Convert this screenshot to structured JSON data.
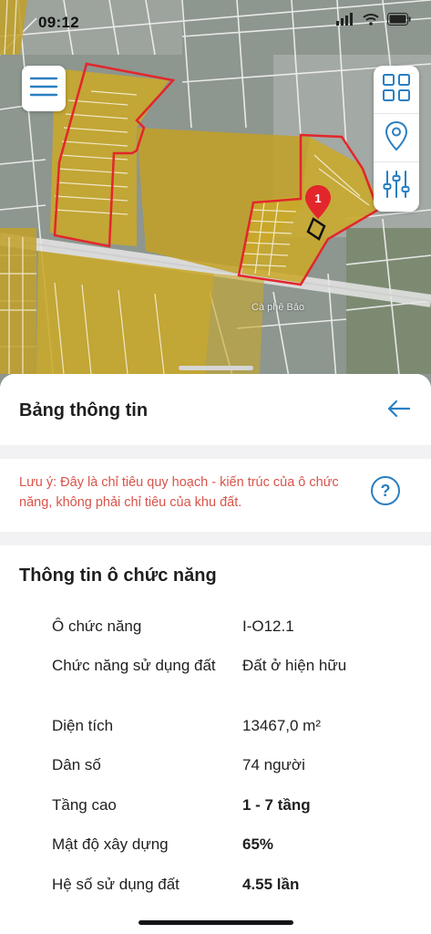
{
  "status_bar": {
    "time": "09:12"
  },
  "map": {
    "place_label": "Cà phê Bảo",
    "marker_number": "1",
    "colors": {
      "zone_fill": "#c9a92a",
      "boundary": "#e3262b",
      "road": "#f5f5f5"
    }
  },
  "controls": {
    "menu_icon": "hamburger-icon",
    "layers_icon": "grid-icon",
    "location_icon": "location-pin-icon",
    "filter_icon": "sliders-icon"
  },
  "sheet": {
    "title": "Bảng thông tin",
    "back_icon": "arrow-left-icon",
    "notice": "Lưu ý: Đây là chỉ tiêu quy hoạch - kiến trúc của ô chức năng, không phải chỉ tiêu của khu đất.",
    "help_label": "?",
    "section_title": "Thông tin ô chức năng",
    "rows": [
      {
        "label": "Ô chức năng",
        "value": "I-O12.1"
      },
      {
        "label": "Chức năng sử dụng đất",
        "value": "Đất ở hiện hữu"
      },
      {
        "label": "Diện tích",
        "value": "13467,0 m²"
      },
      {
        "label": "Dân số",
        "value": "74 người"
      },
      {
        "label": "Tầng cao",
        "value": "1 - 7 tầng"
      },
      {
        "label": "Mật độ xây dựng",
        "value": "65%"
      },
      {
        "label": "Hệ số sử dụng đất",
        "value": "4.55 lần"
      }
    ]
  }
}
